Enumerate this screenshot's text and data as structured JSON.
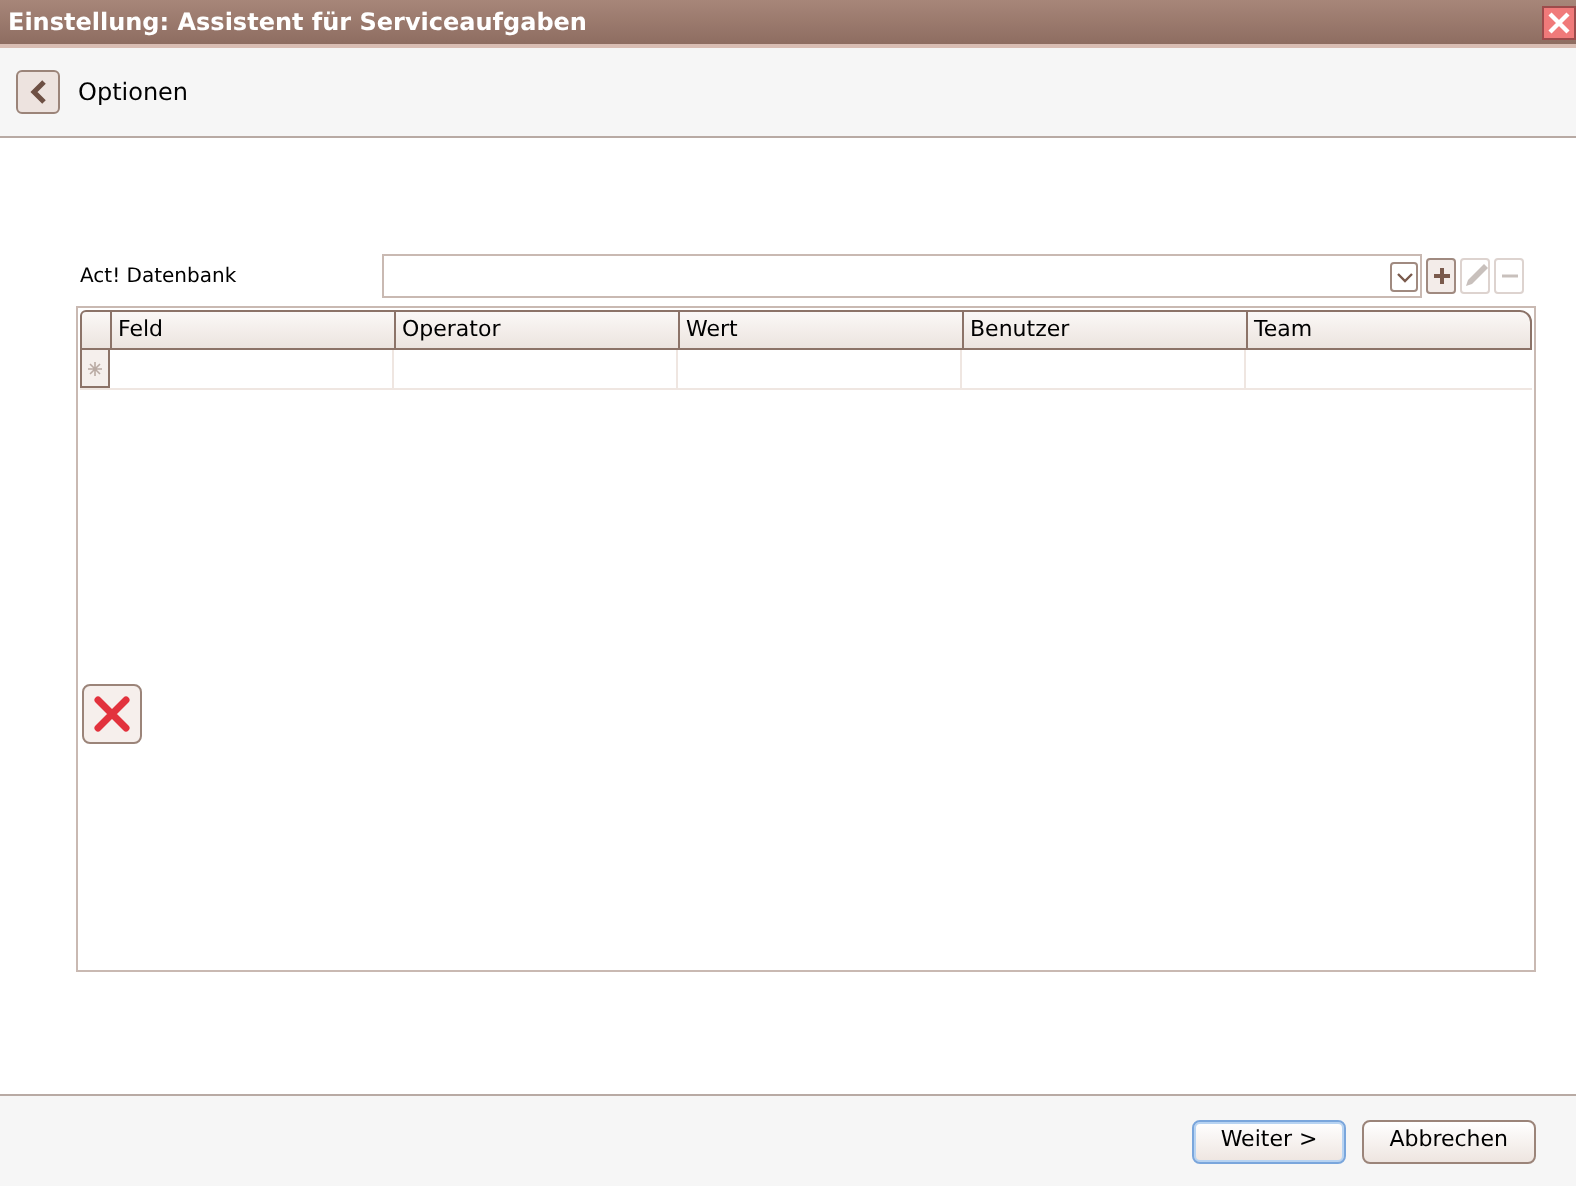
{
  "window": {
    "title": "Einstellung: Assistent für Serviceaufgaben"
  },
  "header": {
    "title": "Optionen"
  },
  "database": {
    "label": "Act! Datenbank",
    "actions": [
      {
        "kind": "dropdown",
        "disabled": false
      },
      {
        "kind": "add",
        "disabled": false
      },
      {
        "kind": "edit",
        "disabled": true
      },
      {
        "kind": "remove",
        "disabled": true
      }
    ]
  },
  "grid": {
    "columns": [
      "Feld",
      "Operator",
      "Wert",
      "Benutzer",
      "Team"
    ]
  },
  "buttons": [
    {
      "label": "Weiter >",
      "default": true
    },
    {
      "label": "Abbrechen",
      "default": false
    }
  ]
}
